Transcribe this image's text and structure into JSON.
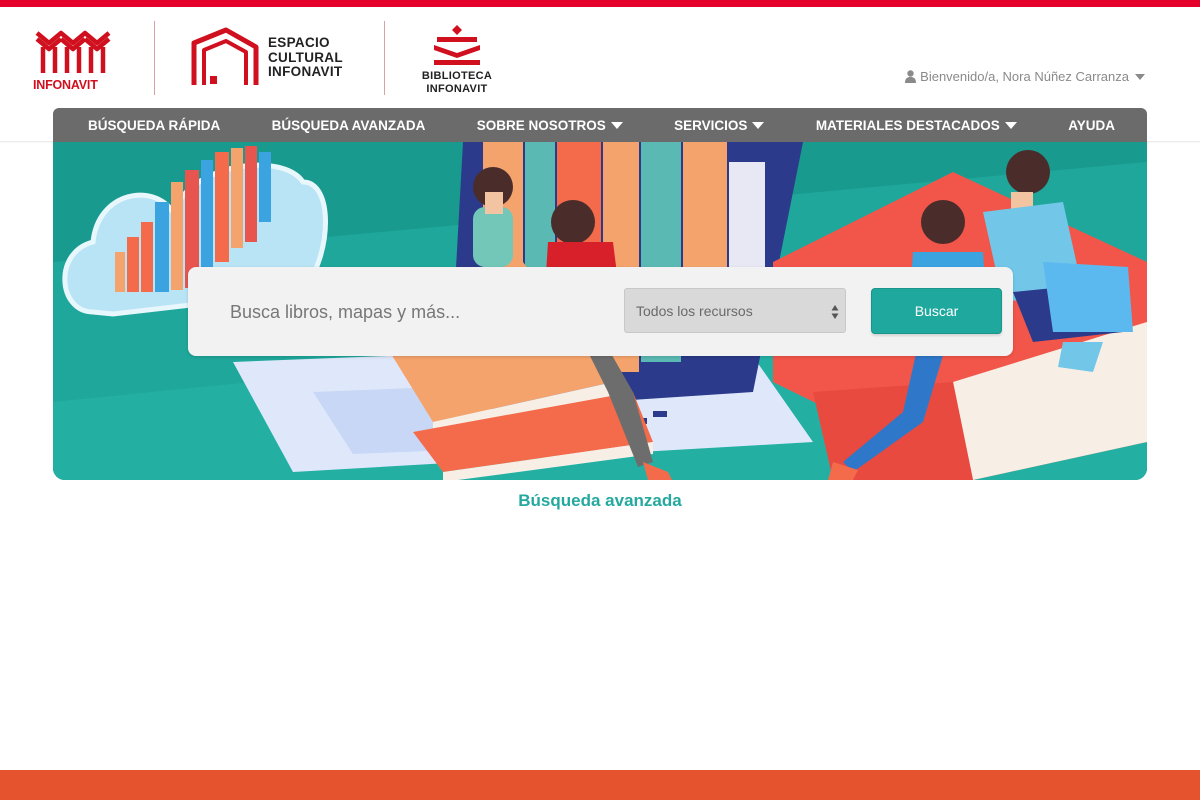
{
  "branding": {
    "infonavit": "INFONAVIT",
    "espacio_cultural": [
      "ESPACIO",
      "CULTURAL",
      "INFONAVIT"
    ],
    "biblioteca": [
      "BIBLIOTECA",
      "INFONAVIT"
    ]
  },
  "user": {
    "greeting": "Bienvenido/a, Nora Núñez Carranza",
    "icon": "user-icon"
  },
  "nav": {
    "items": [
      {
        "label": "BÚSQUEDA RÁPIDA",
        "dropdown": false
      },
      {
        "label": "BÚSQUEDA AVANZADA",
        "dropdown": false
      },
      {
        "label": "SOBRE NOSOTROS",
        "dropdown": true
      },
      {
        "label": "SERVICIOS",
        "dropdown": true
      },
      {
        "label": "MATERIALES DESTACADOS",
        "dropdown": true
      },
      {
        "label": "AYUDA",
        "dropdown": false
      }
    ]
  },
  "search": {
    "placeholder": "Busca libros, mapas y más...",
    "value": "",
    "resource_selected": "Todos los recursos",
    "button_label": "Buscar"
  },
  "links": {
    "advanced_search": "Búsqueda avanzada"
  },
  "colors": {
    "brand_red": "#e4002b",
    "nav_gray": "#6b6b6b",
    "accent_teal": "#1fa89e",
    "footer_orange": "#e4532d"
  }
}
